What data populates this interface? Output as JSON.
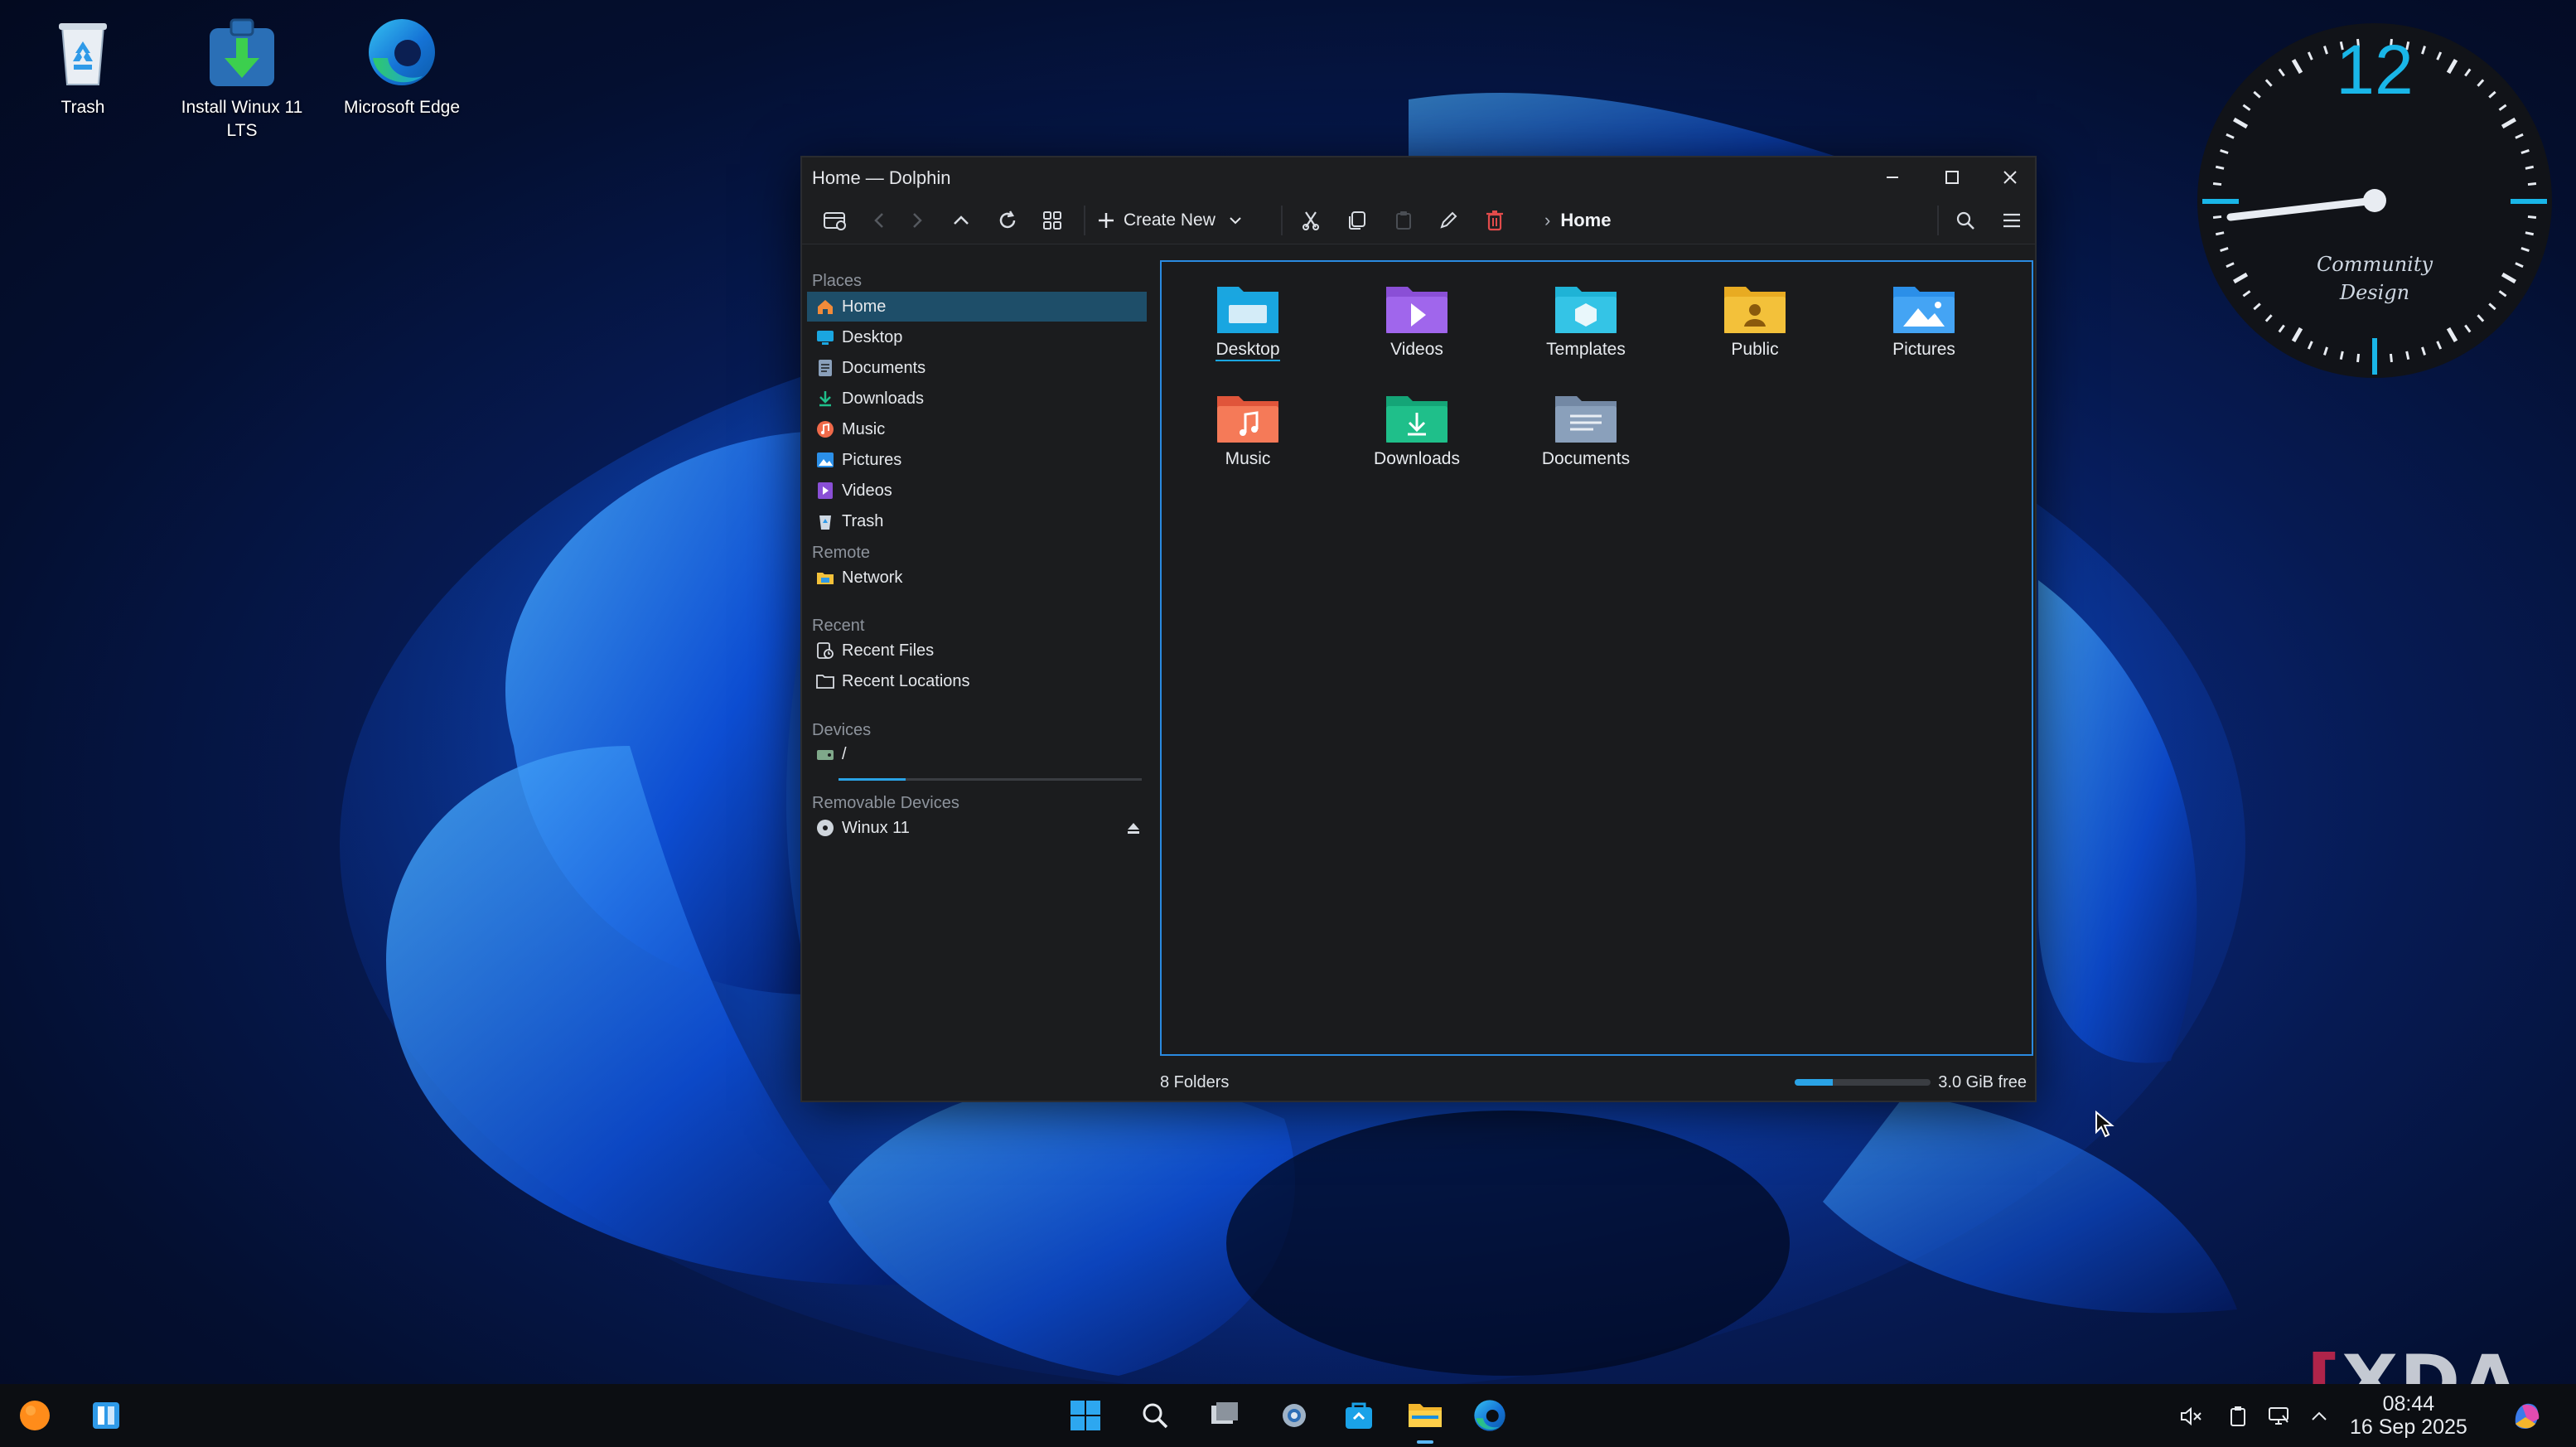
{
  "desktop": {
    "icons": [
      {
        "label_lines": [
          "Trash"
        ],
        "icon": "recycle-bin-icon"
      },
      {
        "label_lines": [
          "Install Winux 11",
          "LTS"
        ],
        "icon": "installer-icon"
      },
      {
        "label_lines": [
          "Microsoft Edge"
        ],
        "icon": "edge-icon"
      }
    ]
  },
  "clock": {
    "hour_number": "12",
    "caption_lines": [
      "Community",
      "Design"
    ]
  },
  "window": {
    "title": "Home — Dolphin",
    "toolbar": {
      "create_new_label": "Create New",
      "breadcrumb": "Home"
    },
    "sidebar": {
      "sections": {
        "places": "Places",
        "remote": "Remote",
        "recent": "Recent",
        "devices": "Devices",
        "removable": "Removable Devices"
      },
      "places": [
        {
          "label": "Home",
          "icon": "home-icon",
          "selected": true
        },
        {
          "label": "Desktop",
          "icon": "desktop-icon"
        },
        {
          "label": "Documents",
          "icon": "documents-icon"
        },
        {
          "label": "Downloads",
          "icon": "downloads-icon"
        },
        {
          "label": "Music",
          "icon": "music-icon"
        },
        {
          "label": "Pictures",
          "icon": "pictures-icon"
        },
        {
          "label": "Videos",
          "icon": "videos-icon"
        },
        {
          "label": "Trash",
          "icon": "trash-icon"
        }
      ],
      "remote": [
        {
          "label": "Network",
          "icon": "network-icon"
        }
      ],
      "recent": [
        {
          "label": "Recent Files",
          "icon": "recent-files-icon"
        },
        {
          "label": "Recent Locations",
          "icon": "recent-locations-icon"
        }
      ],
      "devices": [
        {
          "label": "/",
          "icon": "drive-icon",
          "usage_fraction": 0.22
        }
      ],
      "removable": [
        {
          "label": "Winux 11",
          "icon": "disc-icon"
        }
      ]
    },
    "folders": [
      {
        "label": "Desktop",
        "color": "#1aa6e0"
      },
      {
        "label": "Videos",
        "color": "#8a4fd6"
      },
      {
        "label": "Templates",
        "color": "#1fb3d6"
      },
      {
        "label": "Public",
        "color": "#f3c13a"
      },
      {
        "label": "Pictures",
        "color": "#2b8fe8"
      },
      {
        "label": "Music",
        "color": "#f06a4a"
      },
      {
        "label": "Downloads",
        "color": "#1fbf8a"
      },
      {
        "label": "Documents",
        "color": "#8aa0bb"
      }
    ],
    "status": {
      "count_text": "8 Folders",
      "free_text": "3.0 GiB free",
      "used_fraction": 0.28
    }
  },
  "taskbar": {
    "time": "08:44",
    "date": "16 Sep 2025"
  },
  "watermark": "XDA"
}
